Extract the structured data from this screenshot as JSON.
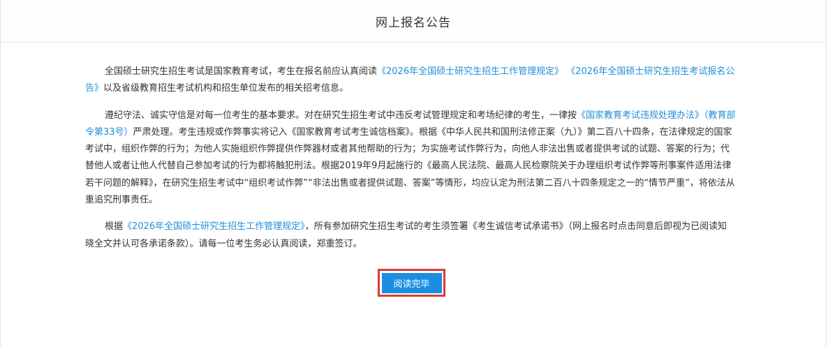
{
  "header": {
    "title": "网上报名公告"
  },
  "paragraphs": {
    "p1": {
      "t1": "全国硕士研究生招生考试是国家教育考试，考生在报名前应认真阅读",
      "l1": "《2026年全国硕士研究生招生工作管理规定》",
      "l2": "《2026年全国硕士研究生招生考试报名公告》",
      "t2": "以及省级教育招生考试机构和招生单位发布的相关招考信息。"
    },
    "p2": {
      "t1": "遵纪守法、诚实守信是对每一位考生的基本要求。对在研究生招生考试中违反考试管理规定和考场纪律的考生，一律按",
      "l1": "《国家教育考试违规处理办法》（教育部令第33号）",
      "t2": "严肃处理。考生违规或作弊事实将记入《国家教育考试考生诚信档案》。根据《中华人民共和国刑法修正案（九）》第二百八十四条，在法律规定的国家考试中，组织作弊的行为；为他人实施组织作弊提供作弊器材或者其他帮助的行为；为实施考试作弊行为，向他人非法出售或者提供考试的试题、答案的行为；代替他人或者让他人代替自己参加考试的行为都将触犯刑法。根据2019年9月起施行的《最高人民法院、最高人民检察院关于办理组织考试作弊等刑事案件适用法律若干问题的解释》，在研究生招生考试中“组织考试作弊”“非法出售或者提供试题、答案”等情形，均应认定为刑法第二百八十四条规定之一的“情节严重”，将依法从重追究刑事责任。"
    },
    "p3": {
      "t1": "根据",
      "l1": "《2026年全国硕士研究生招生工作管理规定》",
      "t2": "，所有参加研究生招生考试的考生须签署《考生诚信考试承诺书》（网上报名时点击同意后即视为已阅读知晓全文并认可各承诺条款）。请每一位考生务必认真阅读，郑重签订。"
    }
  },
  "actions": {
    "read_done_label": "阅读完毕"
  },
  "colors": {
    "link": "#1e8fd8",
    "button": "#1a8ee2",
    "highlight_border": "#d93a3a"
  }
}
